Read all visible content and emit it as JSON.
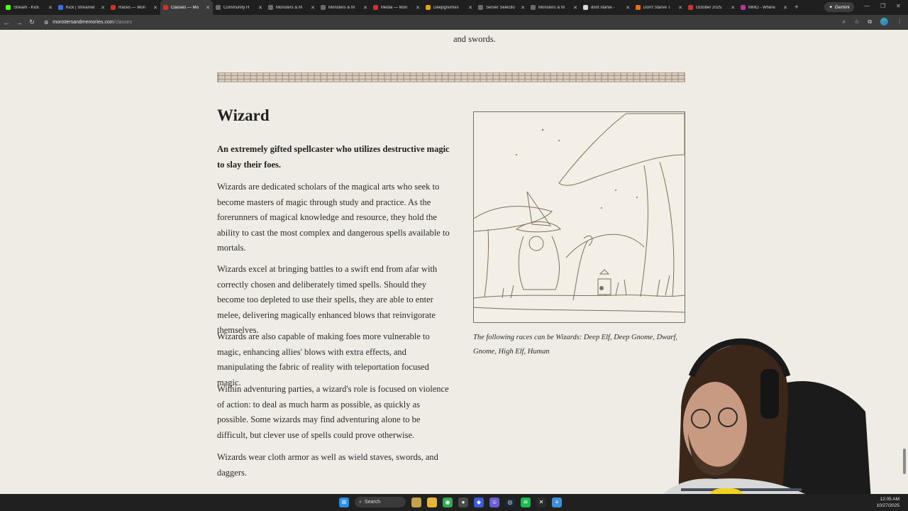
{
  "browser": {
    "tabs": [
      {
        "label": "Stream - Kick",
        "color": "#53fc18",
        "active": false
      },
      {
        "label": "Kick | Streamer",
        "color": "#3b6fd9",
        "active": false
      },
      {
        "label": "Races — Mon",
        "color": "#c0392b",
        "active": false
      },
      {
        "label": "Classes — Mo",
        "color": "#c0392b",
        "active": true
      },
      {
        "label": "Community H",
        "color": "#6b6b6b",
        "active": false
      },
      {
        "label": "Monsters & M",
        "color": "#6b6b6b",
        "active": false
      },
      {
        "label": "Monsters & M",
        "color": "#6b6b6b",
        "active": false
      },
      {
        "label": "Media — Mon",
        "color": "#c0392b",
        "active": false
      },
      {
        "label": "Deepgnomes",
        "color": "#e0a21a",
        "active": false
      },
      {
        "label": "Server Selectio",
        "color": "#6b6b6b",
        "active": false
      },
      {
        "label": "Monsters & M",
        "color": "#6b6b6b",
        "active": false
      },
      {
        "label": "dont starve -",
        "color": "#d9d9d9",
        "active": false
      },
      {
        "label": "Don't Starve T",
        "color": "#e0731a",
        "active": false
      },
      {
        "label": "October 2025",
        "color": "#c0392b",
        "active": false
      },
      {
        "label": "MMO - Where",
        "color": "#b03a9b",
        "active": false
      }
    ],
    "new_tab": "+",
    "gemini_label": "Gemini",
    "url_domain": "monstersandmemories.com",
    "url_path": "/classes"
  },
  "content": {
    "prev_text": "and swords.",
    "heading": "Wizard",
    "lead": "An extremely gifted spellcaster who utilizes destructive magic to slay their foes.",
    "paragraphs": [
      "Wizards are dedicated scholars of the magical arts who seek to become masters of magic through study and practice. As the forerunners of magical knowledge and resource, they hold the ability to cast the most complex and dangerous spells available to mortals.",
      "Wizards excel at bringing battles to a swift end from afar with correctly chosen and deliberately timed spells. Should they become too depleted to use their spells, they are able to enter melee, delivering magically enhanced blows that reinvigorate themselves.",
      "Wizards are also capable of making foes more vulnerable to magic, enhancing allies' blows with extra effects, and manipulating the fabric of reality with teleportation focused magic.",
      "Within adventuring parties, a wizard's role is focused on violence of action: to deal as much harm as possible, as quickly as possible. Some wizards may find adventuring alone to be difficult, but clever use of spells could prove otherwise.",
      "Wizards wear cloth armor as well as wield staves, swords, and daggers."
    ],
    "caption": "The following races can be Wizards: Deep Elf, Deep Gnome, Dwarf, Gnome, High Elf, Human"
  },
  "taskbar": {
    "search_label": "Search",
    "time": "12:05 AM",
    "date": "10/27/2025"
  }
}
